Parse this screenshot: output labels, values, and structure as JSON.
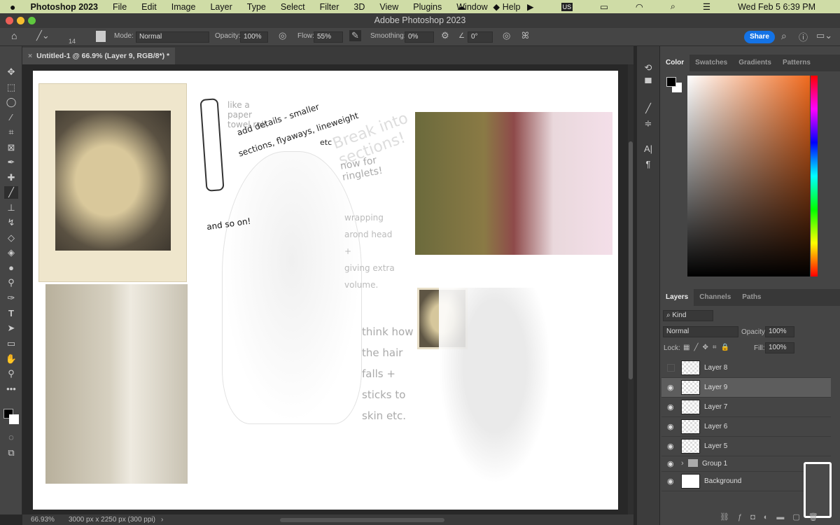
{
  "menubar": {
    "apple": "",
    "app": "Photoshop 2023",
    "items": [
      "File",
      "Edit",
      "Image",
      "Layer",
      "Type",
      "Select",
      "Filter",
      "3D",
      "View",
      "Plugins",
      "Window",
      "Help"
    ],
    "status_icons": [
      "creative-cloud-icon",
      "dropbox-icon",
      "play-icon",
      "input-source-icon",
      "battery-icon",
      "wifi-icon",
      "spotlight-icon",
      "control-center-icon"
    ],
    "input_source": "US",
    "clock": "Wed Feb 5  6:39 PM"
  },
  "window": {
    "title": "Adobe Photoshop 2023"
  },
  "options": {
    "brush_size": "14",
    "mode_label": "Mode:",
    "mode": "Normal",
    "opacity_label": "Opacity:",
    "opacity": "100%",
    "flow_label": "Flow:",
    "flow": "55%",
    "smoothing_label": "Smoothing:",
    "smoothing": "0%",
    "angle": "0°",
    "share": "Share"
  },
  "document": {
    "tab": "Untitled-1 @ 66.9% (Layer 9, RGB/8*) *",
    "close": "×"
  },
  "canvas_notes": {
    "n1": "like a paper towel roll.",
    "n2": "add details - smaller",
    "n3": "sections, flyaways, lineweight",
    "n4": "etc",
    "n5": "Break into sections!",
    "n6": "now for ringlets!",
    "n7": "wrapping arond head +",
    "n8": "giving extra volume.",
    "n9": "and so on!",
    "n10": "think how the hair falls +",
    "n11": "sticks to skin etc."
  },
  "status": {
    "zoom": "66.93%",
    "doc_info": "3000 px x 2250 px (300 ppi)",
    "arrow": "›"
  },
  "color_panel": {
    "tabs": [
      "Color",
      "Swatches",
      "Gradients",
      "Patterns"
    ]
  },
  "layers_panel": {
    "tabs": [
      "Layers",
      "Channels",
      "Paths"
    ],
    "filter": "Kind",
    "blend": "Normal",
    "opacity_label": "Opacity:",
    "opacity": "100%",
    "lock_label": "Lock:",
    "fill_label": "Fill:",
    "fill": "100%",
    "layers": [
      {
        "name": "Layer 8",
        "visible": false
      },
      {
        "name": "Layer 9",
        "visible": true,
        "selected": true
      },
      {
        "name": "Layer 7",
        "visible": true
      },
      {
        "name": "Layer 6",
        "visible": true
      },
      {
        "name": "Layer 5",
        "visible": true
      },
      {
        "name": "Group 1",
        "visible": true,
        "group": true
      },
      {
        "name": "Background",
        "visible": true
      }
    ]
  },
  "colors": {
    "accent": "#1473e6",
    "foreground": "#000000",
    "background": "#ffffff"
  }
}
